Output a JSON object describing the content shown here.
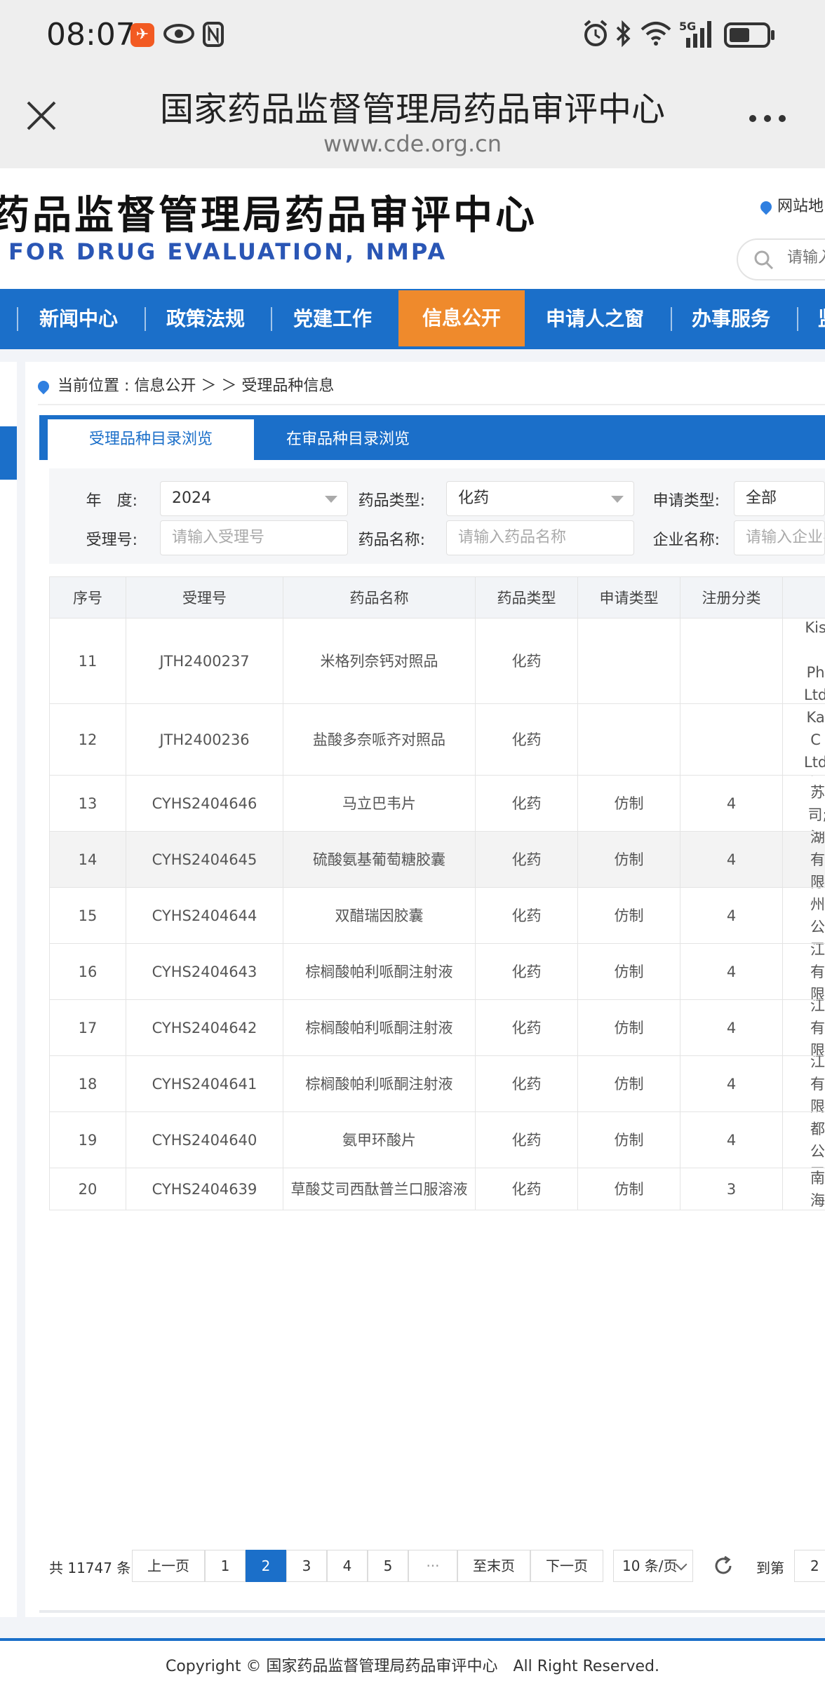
{
  "status_bar": {
    "time": "08:07",
    "network": "5G"
  },
  "browser": {
    "title": "国家药品监督管理局药品审评中心",
    "url": "www.cde.org.cn"
  },
  "header": {
    "title_cn": "药品监督管理局药品审评中心",
    "title_en": "FOR DRUG EVALUATION, NMPA",
    "sitemap_label": "网站地",
    "search_placeholder": "请输入"
  },
  "nav": {
    "items": [
      {
        "label": "新闻中心"
      },
      {
        "label": "政策法规"
      },
      {
        "label": "党建工作"
      },
      {
        "label": "信息公开",
        "active": true
      },
      {
        "label": "申请人之窗"
      },
      {
        "label": "办事服务"
      },
      {
        "label": "监"
      }
    ]
  },
  "breadcrumb": {
    "text": "当前位置 : 信息公开 ＞ ＞ 受理品种信息"
  },
  "tabs": [
    {
      "label": "受理品种目录浏览",
      "active": true
    },
    {
      "label": "在审品种目录浏览",
      "active": false
    }
  ],
  "filters": {
    "year_label": "年　度:",
    "year_value": "2024",
    "drug_type_label": "药品类型:",
    "drug_type_value": "化药",
    "apply_type_label": "申请类型:",
    "apply_type_value": "全部",
    "accept_no_label": "受理号:",
    "accept_no_placeholder": "请输入受理号",
    "drug_name_label": "药品名称:",
    "drug_name_placeholder": "请输入药品名称",
    "company_label": "企业名称:",
    "company_placeholder": "请输入企业名"
  },
  "table": {
    "columns": [
      "序号",
      "受理号",
      "药品名称",
      "药品类型",
      "申请类型",
      "注册分类",
      ""
    ],
    "rows": [
      {
        "no": "11",
        "accept_no": "JTH2400237",
        "drug_name": "米格列奈钙对照品",
        "drug_type": "化药",
        "apply_type": "",
        "reg_class": "",
        "company": "Kis\n\nPh\nLtd"
      },
      {
        "no": "12",
        "accept_no": "JTH2400236",
        "drug_name": "盐酸多奈哌齐对照品",
        "drug_type": "化药",
        "apply_type": "",
        "reg_class": "",
        "company": "Ka\nC\nLtd"
      },
      {
        "no": "13",
        "accept_no": "CYHS2404646",
        "drug_name": "马立巴韦片",
        "drug_type": "化药",
        "apply_type": "仿制",
        "reg_class": "4",
        "company": "江苏\n司;江"
      },
      {
        "no": "14",
        "accept_no": "CYHS2404645",
        "drug_name": "硫酸氨基葡萄糖胶囊",
        "drug_type": "化药",
        "apply_type": "仿制",
        "reg_class": "4",
        "company": "西湖\n有限\n湖"
      },
      {
        "no": "15",
        "accept_no": "CYHS2404644",
        "drug_name": "双醋瑞因胶囊",
        "drug_type": "化药",
        "apply_type": "仿制",
        "reg_class": "4",
        "company": "苏州\n公司"
      },
      {
        "no": "16",
        "accept_no": "CYHS2404643",
        "drug_name": "棕榈酸帕利哌酮注射液",
        "drug_type": "化药",
        "apply_type": "仿制",
        "reg_class": "4",
        "company": "浙江\n有限\n技"
      },
      {
        "no": "17",
        "accept_no": "CYHS2404642",
        "drug_name": "棕榈酸帕利哌酮注射液",
        "drug_type": "化药",
        "apply_type": "仿制",
        "reg_class": "4",
        "company": "浙江\n有限\n技"
      },
      {
        "no": "18",
        "accept_no": "CYHS2404641",
        "drug_name": "棕榈酸帕利哌酮注射液",
        "drug_type": "化药",
        "apply_type": "仿制",
        "reg_class": "4",
        "company": "浙江\n有限\n技"
      },
      {
        "no": "19",
        "accept_no": "CYHS2404640",
        "drug_name": "氨甲环酸片",
        "drug_type": "化药",
        "apply_type": "仿制",
        "reg_class": "4",
        "company": "成都\n公司"
      },
      {
        "no": "20",
        "accept_no": "CYHS2404639",
        "drug_name": "草酸艾司西酞普兰口服溶液",
        "drug_type": "化药",
        "apply_type": "仿制",
        "reg_class": "3",
        "company": "海南\n海南"
      }
    ]
  },
  "pagination": {
    "total": "共 11747 条",
    "prev": "上一页",
    "pages": [
      "1",
      "2",
      "3",
      "4",
      "5",
      "···"
    ],
    "current_page": "2",
    "last": "至末页",
    "next": "下一页",
    "page_size": "10 条/页",
    "goto_label": "到第",
    "goto_value": "2"
  },
  "footer": {
    "copyright": "Copyright © 国家药品监督管理局药品审评中心　All Right Reserved."
  }
}
